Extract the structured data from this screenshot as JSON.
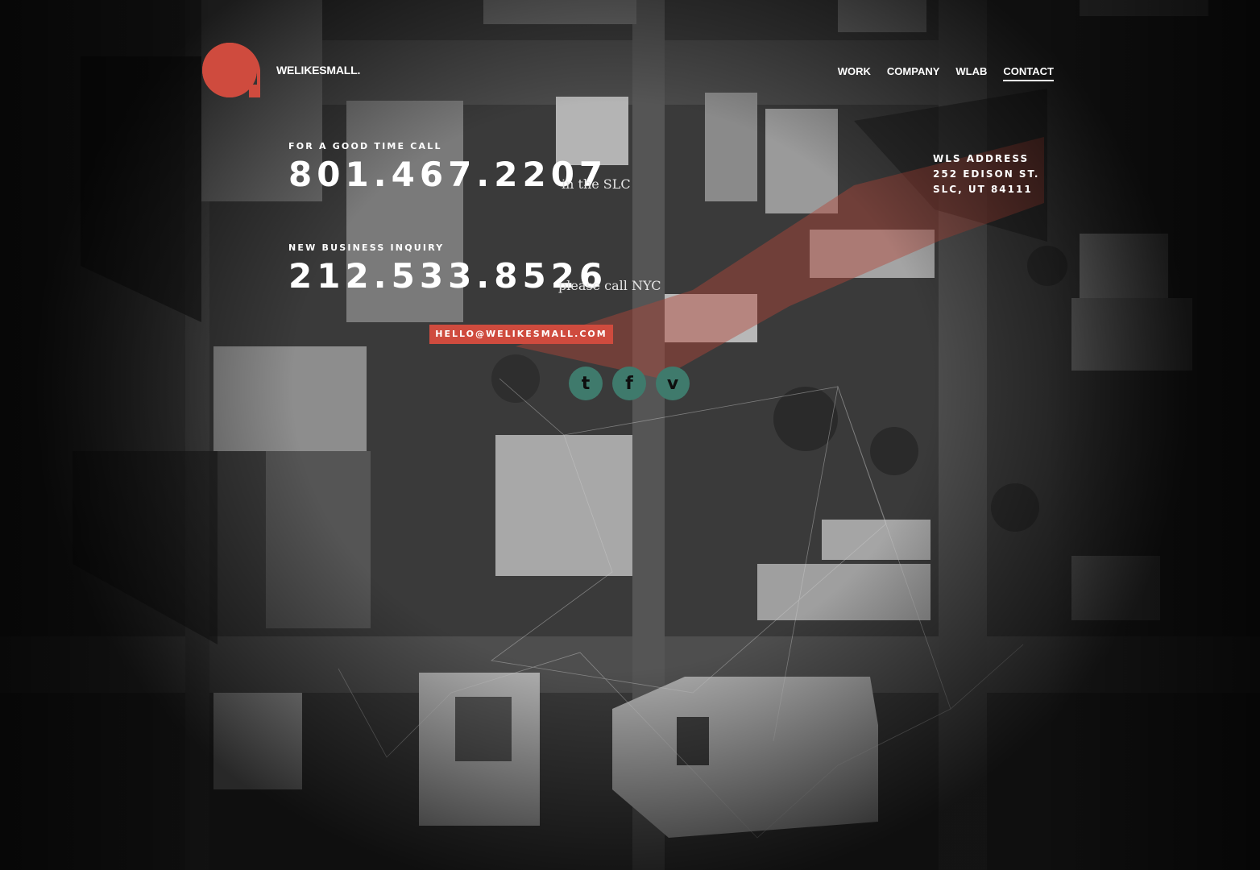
{
  "header": {
    "brand": "WELIKESMALL.",
    "nav": [
      {
        "label": "WORK",
        "active": false
      },
      {
        "label": "COMPANY",
        "active": false
      },
      {
        "label": "WLAB",
        "active": false
      },
      {
        "label": "CONTACT",
        "active": true
      }
    ]
  },
  "contact": {
    "good_time": {
      "label": "FOR A GOOD TIME CALL",
      "phone": "801.467.2207",
      "note": "in the SLC"
    },
    "new_business": {
      "label": "NEW BUSINESS INQUIRY",
      "phone": "212.533.8526",
      "note": "please call NYC"
    },
    "email": "HELLO@WELIKESMALL.COM",
    "social": [
      {
        "name": "twitter",
        "glyph": "t"
      },
      {
        "name": "facebook",
        "glyph": "f"
      },
      {
        "name": "vimeo",
        "glyph": "v"
      }
    ]
  },
  "address": {
    "title": "WLS ADDRESS",
    "line1": "252 EDISON ST.",
    "line2": "SLC, UT 84111"
  },
  "colors": {
    "accent": "#cf4b3e",
    "social": "#3f7a6c",
    "background": "#2b2b2b"
  }
}
